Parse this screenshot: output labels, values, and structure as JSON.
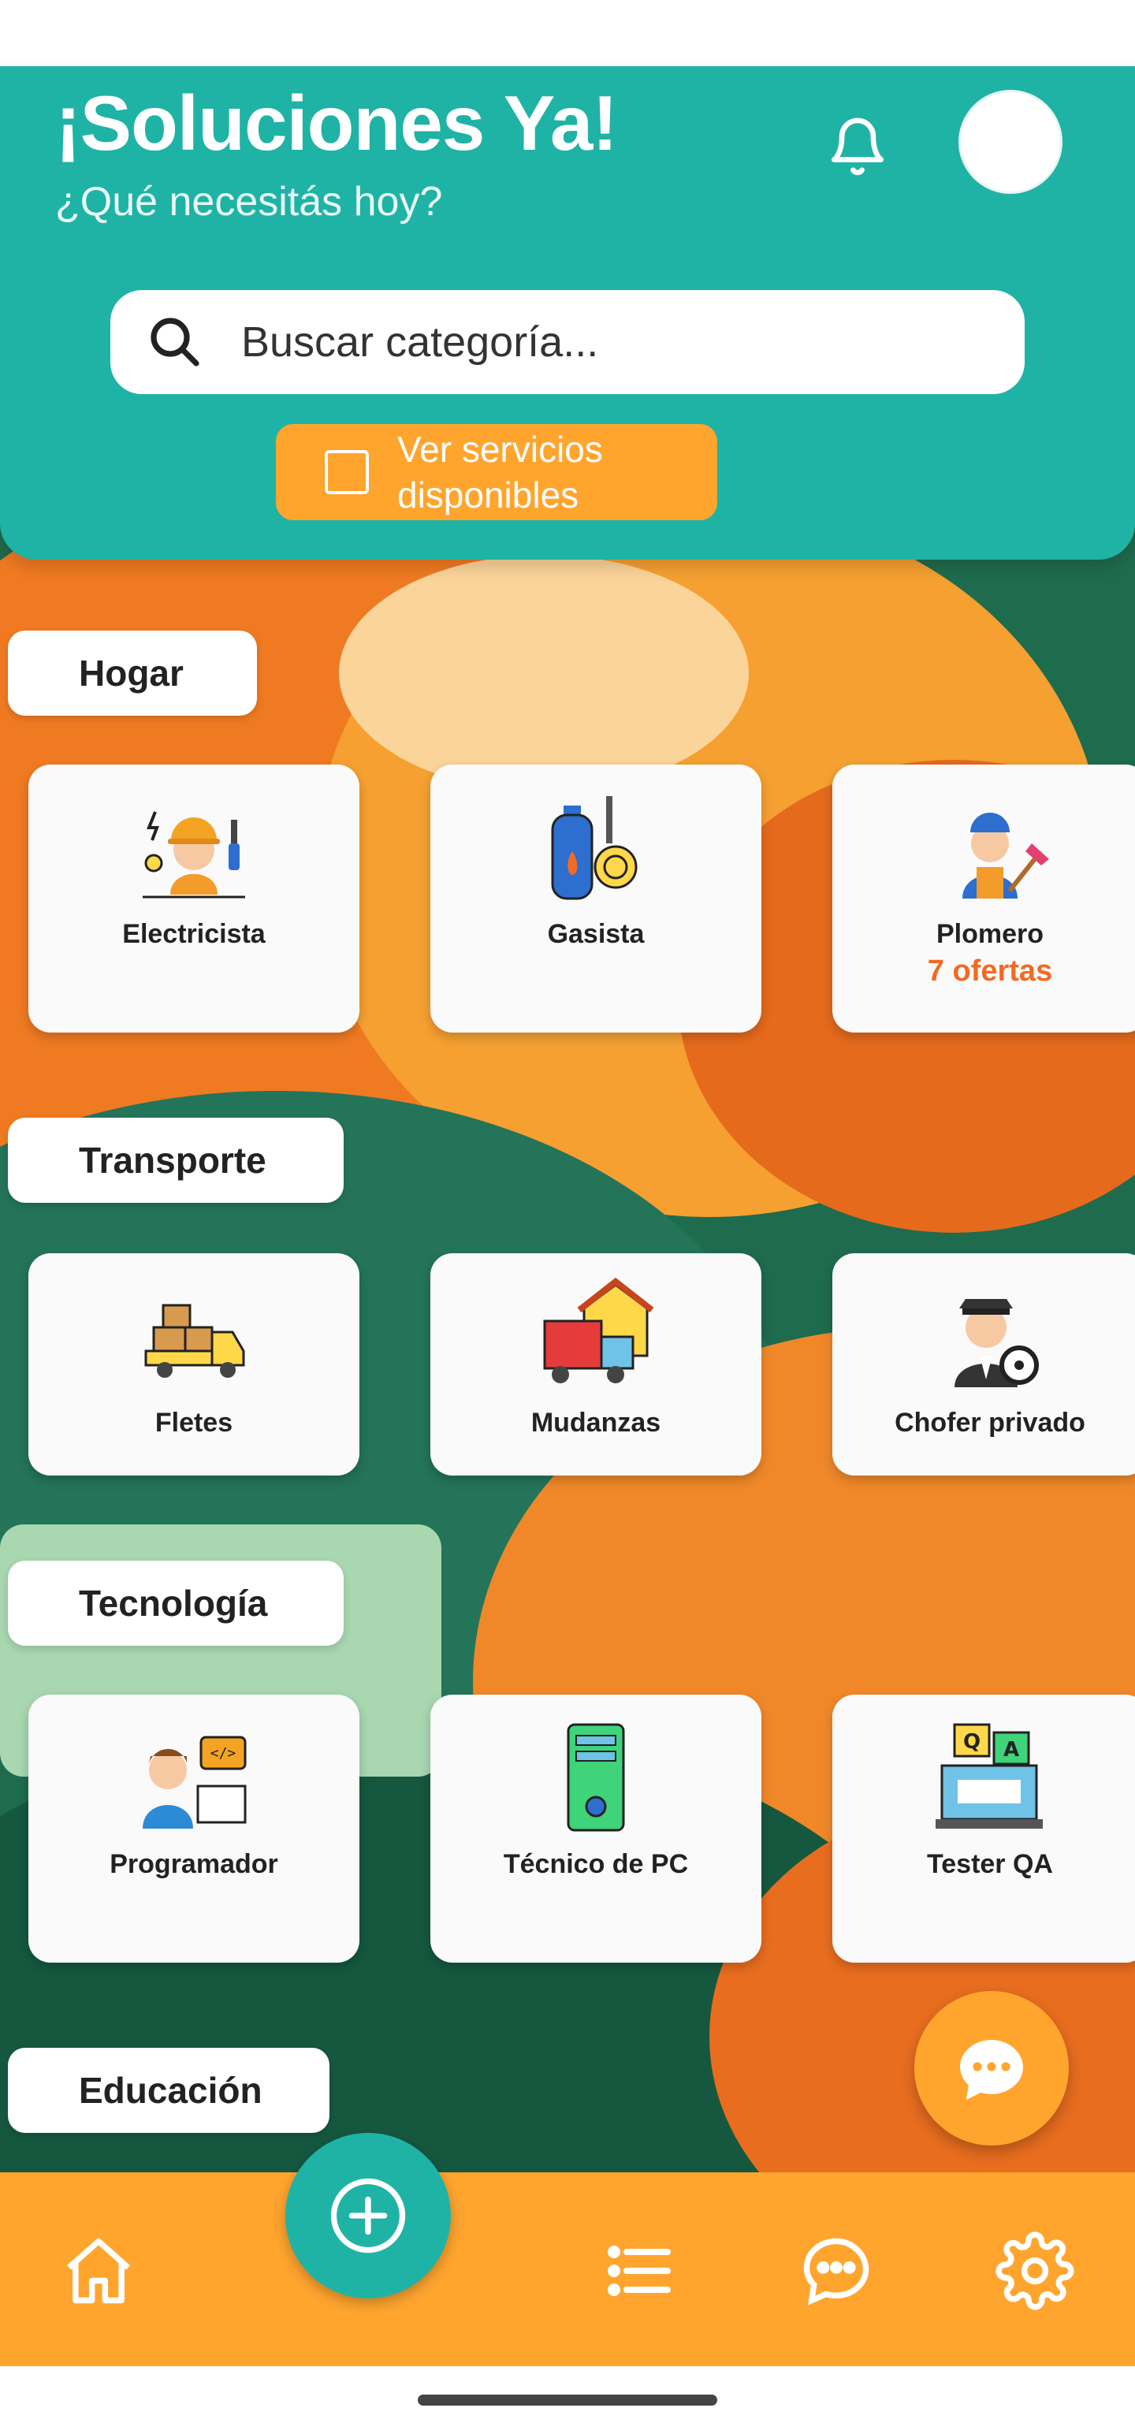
{
  "header": {
    "title": "¡Soluciones Ya!",
    "subtitle": "¿Qué necesitás hoy?",
    "search_placeholder": "Buscar categoría...",
    "available_services_label": "Ver servicios disponibles",
    "colors": {
      "primary": "#1fb3a6",
      "accent": "#ffa52e"
    }
  },
  "sections": [
    {
      "label": "Hogar",
      "cards": [
        {
          "name": "Electricista",
          "icon": "electrician-icon"
        },
        {
          "name": "Gasista",
          "icon": "gas-cylinder-icon"
        },
        {
          "name": "Plomero",
          "icon": "plumber-icon",
          "offers": "7 ofertas"
        }
      ]
    },
    {
      "label": "Transporte",
      "cards": [
        {
          "name": "Fletes",
          "icon": "delivery-truck-icon"
        },
        {
          "name": "Mudanzas",
          "icon": "moving-truck-house-icon"
        },
        {
          "name": "Chofer privado",
          "icon": "chauffeur-icon"
        }
      ]
    },
    {
      "label": "Tecnología",
      "cards": [
        {
          "name": "Programador",
          "icon": "programmer-icon"
        },
        {
          "name": "Técnico de PC",
          "icon": "pc-tower-icon"
        },
        {
          "name": "Tester QA",
          "icon": "qa-tester-icon"
        }
      ]
    },
    {
      "label": "Educación",
      "cards": []
    }
  ],
  "nav": {
    "items": [
      "home-icon",
      "add-icon",
      "list-icon",
      "chat-icon",
      "settings-icon"
    ]
  }
}
